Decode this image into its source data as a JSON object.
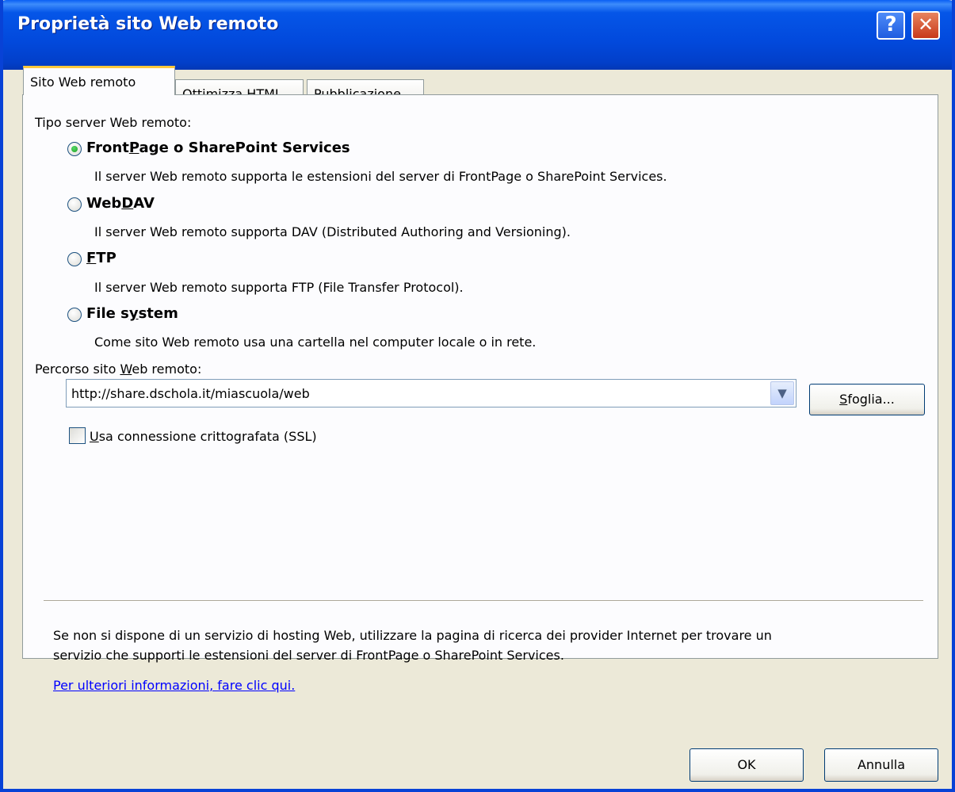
{
  "window": {
    "title": "Proprietà sito Web remoto"
  },
  "titlebar_buttons": {
    "help": "?",
    "close": "✕"
  },
  "tabs": [
    {
      "label": "Sito Web remoto",
      "active": true
    },
    {
      "label": "Ottimizza HTML",
      "active": false
    },
    {
      "label": "Pubblicazione",
      "active": false
    }
  ],
  "server_type": {
    "label": "Tipo server Web remoto:",
    "options": [
      {
        "label_pre": "Front",
        "label_ul": "P",
        "label_post": "age o SharePoint Services",
        "description": "Il server Web remoto supporta le estensioni del server di FrontPage o SharePoint Services.",
        "selected": true
      },
      {
        "label_pre": "Web",
        "label_ul": "D",
        "label_post": "AV",
        "description": "Il server Web remoto supporta DAV (Distributed Authoring and Versioning).",
        "selected": false
      },
      {
        "label_pre": "",
        "label_ul": "F",
        "label_post": "TP",
        "description": "Il server Web remoto supporta FTP (File Transfer Protocol).",
        "selected": false
      },
      {
        "label_pre": "File s",
        "label_ul": "y",
        "label_post": "stem",
        "description": "Come sito Web remoto usa una cartella nel computer locale o in rete.",
        "selected": false
      }
    ]
  },
  "path": {
    "label_pre": "Percorso sito ",
    "label_ul": "W",
    "label_post": "eb remoto:",
    "value": "http://share.dschola.it/miascuola/web",
    "browse_ul": "S",
    "browse_post": "foglia..."
  },
  "ssl": {
    "label_ul": "U",
    "label_post": "sa connessione crittografata (SSL)",
    "checked": false
  },
  "info": {
    "line1": "Se non si dispone di un servizio di hosting Web, utilizzare la pagina di ricerca dei provider Internet per trovare un",
    "line2": "servizio che supporti le estensioni del server di FrontPage o SharePoint Services.",
    "link": "Per ulteriori informazioni, fare clic qui."
  },
  "buttons": {
    "ok": "OK",
    "cancel": "Annulla"
  },
  "colors": {
    "titlebar": "#0249DC",
    "face": "#ECE9D8",
    "panel": "#FCFCFE",
    "link": "#0000FF",
    "tab_accent": "#FFC83C"
  }
}
